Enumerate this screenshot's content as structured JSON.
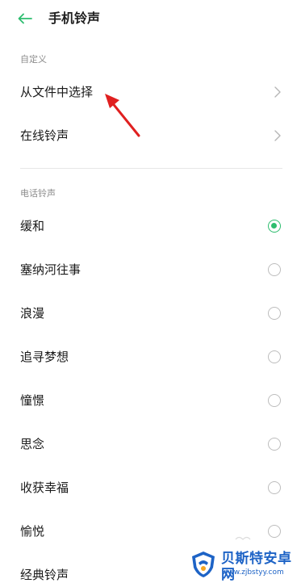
{
  "header": {
    "title": "手机铃声",
    "back_icon": "arrow-left-icon",
    "accent_color": "#2dbd6e"
  },
  "custom_section": {
    "title": "自定义",
    "items": [
      {
        "label": "从文件中选择"
      },
      {
        "label": "在线铃声"
      }
    ]
  },
  "ringtone_section": {
    "title": "电话铃声",
    "selected": "缓和",
    "items": [
      {
        "label": "缓和",
        "checked": true
      },
      {
        "label": "塞纳河往事",
        "checked": false
      },
      {
        "label": "浪漫",
        "checked": false
      },
      {
        "label": "追寻梦想",
        "checked": false
      },
      {
        "label": "憧憬",
        "checked": false
      },
      {
        "label": "思念",
        "checked": false
      },
      {
        "label": "收获幸福",
        "checked": false
      },
      {
        "label": "愉悦",
        "checked": false
      },
      {
        "label": "经典铃声",
        "checked": false
      }
    ]
  },
  "annotation": {
    "icon": "red-arrow-icon",
    "color": "#e02020"
  },
  "watermark": {
    "name": "贝斯特安卓网",
    "url": "www.zjbstyy.com"
  }
}
